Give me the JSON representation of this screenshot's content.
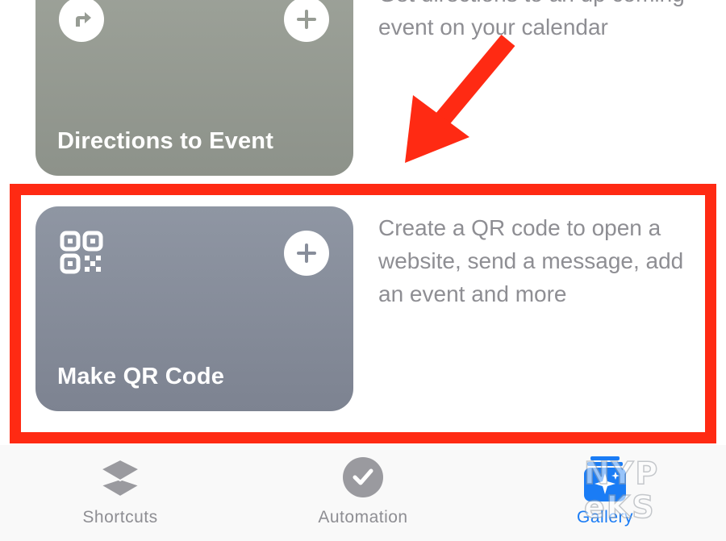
{
  "gallery": {
    "directions_card": {
      "title": "Directions to Event",
      "description": "Get directions to an up coming event on your calendar",
      "icon": "directions-arrow-icon",
      "color": "#979c94"
    },
    "qr_card": {
      "title": "Make QR Code",
      "description": "Create a QR code to open a website, send a message, add an event and more",
      "icon": "qr-code-icon",
      "color": "#878d9a"
    }
  },
  "annotation": {
    "highlight_color": "#ff2a13"
  },
  "tabbar": {
    "tabs": [
      {
        "label": "Shortcuts",
        "icon": "layers-icon",
        "active": false
      },
      {
        "label": "Automation",
        "icon": "checkmark-clock-icon",
        "active": false
      },
      {
        "label": "Gallery",
        "icon": "gallery-sparkle-icon",
        "active": true
      }
    ],
    "active_color": "#1a7cf5",
    "inactive_color": "#8e8e93"
  },
  "watermark": {
    "row1": "NYP",
    "row2": "eKS"
  }
}
